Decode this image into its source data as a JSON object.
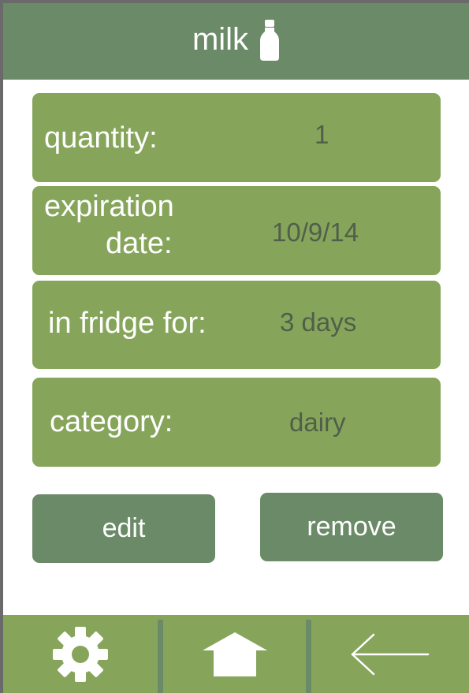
{
  "header": {
    "title": "milk",
    "icon": "milk-bottle-icon"
  },
  "details": {
    "quantity": {
      "label": "quantity:",
      "value": "1"
    },
    "expiration": {
      "label_line1": "expiration",
      "label_line2": "date:",
      "value": "10/9/14"
    },
    "in_fridge": {
      "label": "in fridge for:",
      "value": "3 days"
    },
    "category": {
      "label": "category:",
      "value": "dairy"
    }
  },
  "actions": {
    "edit_label": "edit",
    "remove_label": "remove"
  },
  "nav": {
    "items": [
      {
        "icon": "gear-icon"
      },
      {
        "icon": "home-icon"
      },
      {
        "icon": "back-arrow-icon"
      }
    ]
  },
  "colors": {
    "header": "#6b8a67",
    "card": "#86a55b",
    "button": "#6b8a67",
    "value_text": "#4f5f49",
    "frame": "#6a6a6a"
  }
}
